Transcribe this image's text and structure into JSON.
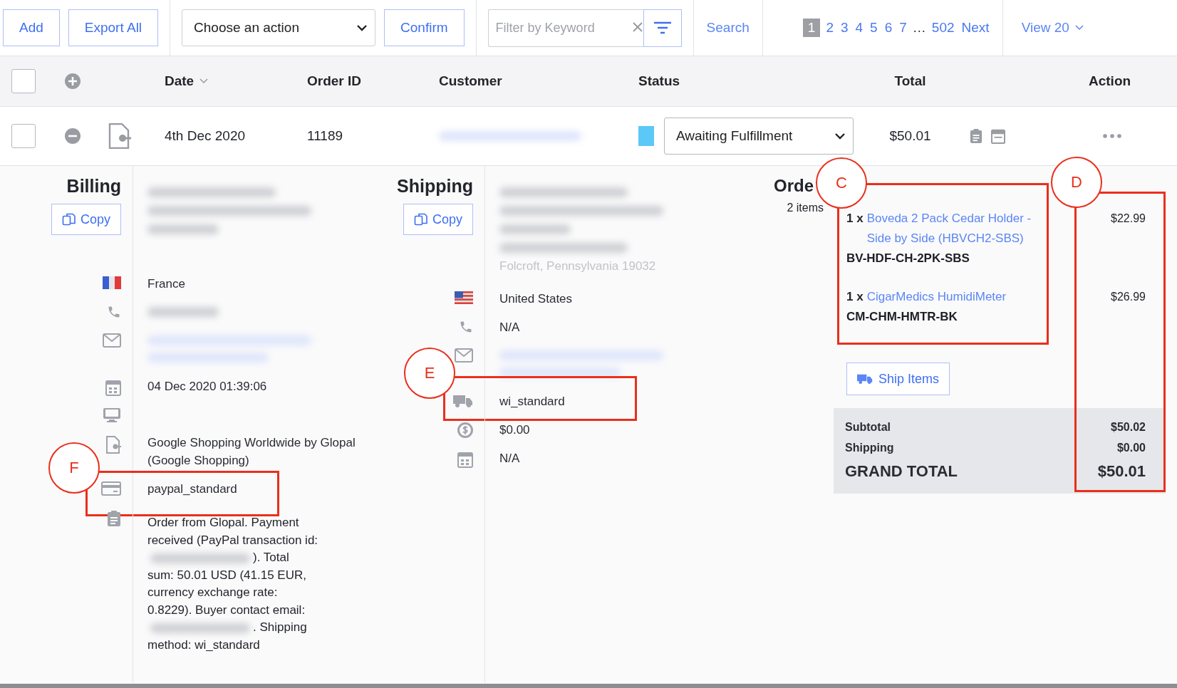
{
  "toolbar": {
    "add": "Add",
    "export": "Export All",
    "action_select": "Choose an action",
    "confirm": "Confirm",
    "filter": {
      "placeholder": "Filter by Keyword"
    },
    "search": "Search",
    "pagination": {
      "pages": [
        {
          "label": "1",
          "selected": true
        },
        {
          "label": "2",
          "selected": false
        },
        {
          "label": "3",
          "selected": false
        },
        {
          "label": "4",
          "selected": false
        },
        {
          "label": "5",
          "selected": false
        },
        {
          "label": "6",
          "selected": false
        },
        {
          "label": "7",
          "selected": false
        }
      ],
      "ellipsis": "…",
      "last_page": "502",
      "next": "Next"
    },
    "view": "View 20"
  },
  "table": {
    "header_checked": false,
    "columns": [
      "Date",
      "Order ID",
      "Customer",
      "Status",
      "Total",
      "Action"
    ],
    "rows": [
      {
        "checked": false,
        "expanded": true,
        "date": "4th Dec 2020",
        "order_id": "11189",
        "color": "#5bc8f7",
        "status": "Awaiting Fulfillment",
        "total": "$50.01"
      }
    ]
  },
  "billing": {
    "title": "Billing",
    "copy": "Copy",
    "address": [
      {
        "kind": "blurred"
      },
      {
        "kind": "blurred"
      },
      {
        "kind": "blurred"
      }
    ],
    "rows": [
      {
        "kind": "flag-fr",
        "value": "France"
      },
      {
        "kind": "phone"
      },
      {
        "kind": "email"
      },
      {
        "kind": "calendar",
        "value": "04 Dec 2020 01:39:06"
      },
      {
        "kind": "ip"
      },
      {
        "kind": "source",
        "value": "Google Shopping Worldwide by Glopal (Google Shopping)"
      },
      {
        "kind": "card",
        "value": "paypal_standard",
        "callout": "F"
      }
    ],
    "note": [
      {
        "kind": "text",
        "text": "Order from Glopal. Payment received (PayPal transaction id:"
      },
      {
        "kind": "blurred"
      },
      {
        "kind": "text",
        "text": "). Total sum: 50.01 USD (41.15 EUR, currency exchange rate: 0.8229). Buyer contact email:"
      },
      {
        "kind": "blurred"
      },
      {
        "kind": "text",
        "text": ". Shipping method: wi_standard"
      }
    ]
  },
  "shipping": {
    "title": "Shipping",
    "copy": "Copy",
    "address": [
      {
        "kind": "blurred"
      },
      {
        "kind": "blurred"
      },
      {
        "kind": "blurred"
      },
      {
        "kind": "blurred"
      },
      {
        "kind": "text",
        "value": "Folcroft, Pennsylvania 19032",
        "faded": true
      }
    ],
    "rows": [
      {
        "kind": "flag-us",
        "value": "United States"
      },
      {
        "kind": "phone",
        "value": "N/A"
      },
      {
        "kind": "email"
      },
      {
        "kind": "truck",
        "value": "wi_standard",
        "callout": "E"
      },
      {
        "kind": "dollar",
        "value": "$0.00"
      },
      {
        "kind": "calendar",
        "value": "N/A"
      }
    ]
  },
  "order": {
    "title": "Orde",
    "count": "2 items",
    "items_callout": "C",
    "prices_callout": "D",
    "items": [
      {
        "qty": "1 x",
        "name": "Boveda 2 Pack Cedar Holder - Side by Side (HBVCH2-SBS)",
        "sku": "BV-HDF-CH-2PK-SBS",
        "price": "$22.99"
      },
      {
        "qty": "1 x",
        "name": "CigarMedics HumidiMeter",
        "sku": "CM-CHM-HMTR-BK",
        "price": "$26.99"
      }
    ],
    "ship_button": "Ship Items",
    "totals": [
      {
        "kind": "normal",
        "label": "Subtotal",
        "value": "$50.02"
      },
      {
        "kind": "normal",
        "label": "Shipping",
        "value": "$0.00"
      },
      {
        "kind": "grand",
        "label": "GRAND TOTAL",
        "value": "$50.01"
      }
    ]
  }
}
